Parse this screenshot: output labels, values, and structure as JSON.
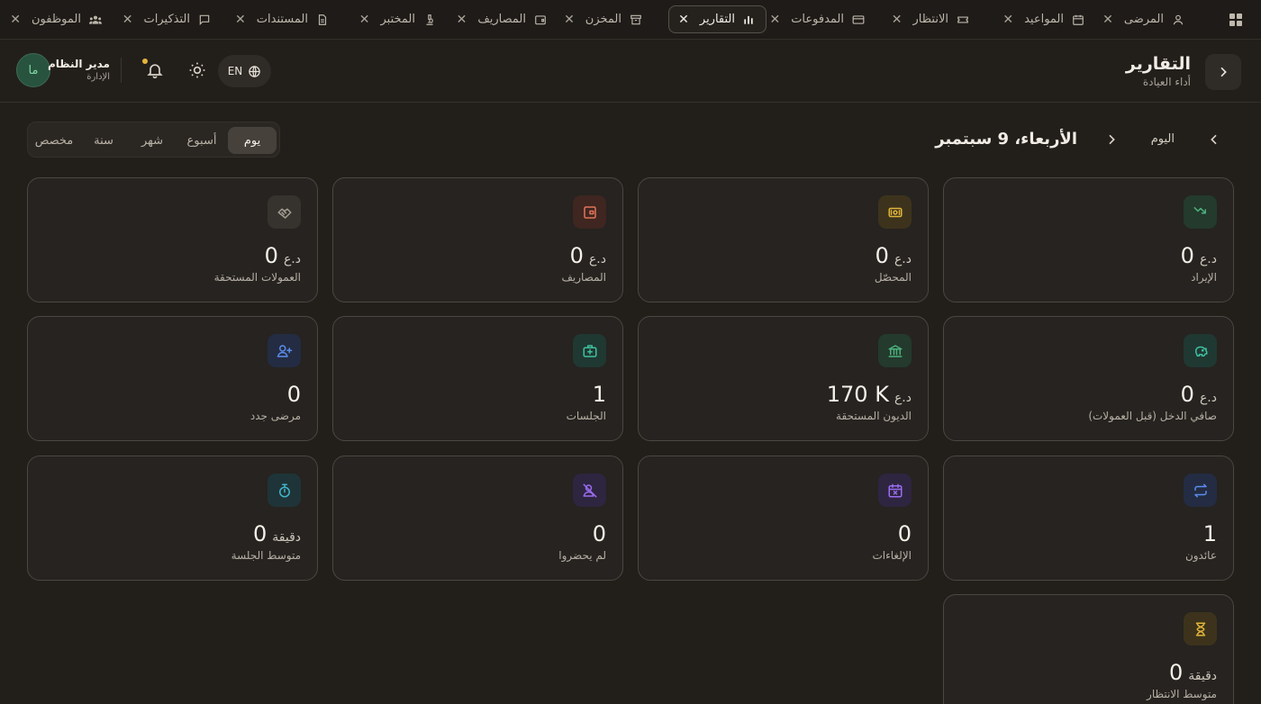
{
  "tabs": [
    {
      "label": "المرضى",
      "icon": "person-icon",
      "active": false
    },
    {
      "label": "المواعيد",
      "icon": "calendar-icon",
      "active": false
    },
    {
      "label": "الانتظار",
      "icon": "ticket-icon",
      "active": false
    },
    {
      "label": "المدفوعات",
      "icon": "credit-card-icon",
      "active": false
    },
    {
      "label": "التقارير",
      "icon": "bar-chart-icon",
      "active": true
    },
    {
      "label": "المخزن",
      "icon": "archive-icon",
      "active": false
    },
    {
      "label": "المصاريف",
      "icon": "wallet-icon",
      "active": false
    },
    {
      "label": "المختبر",
      "icon": "microscope-icon",
      "active": false
    },
    {
      "label": "المستندات",
      "icon": "document-icon",
      "active": false
    },
    {
      "label": "التذكيرات",
      "icon": "message-icon",
      "active": false
    },
    {
      "label": "الموظفون",
      "icon": "team-icon",
      "active": false
    }
  ],
  "header": {
    "title": "التقارير",
    "subtitle": "أداء العيادة",
    "language": "EN",
    "user": {
      "name": "مدير النظام",
      "role": "الإدارة",
      "initials": "ما"
    }
  },
  "period": {
    "options": [
      "يوم",
      "أسبوع",
      "شهر",
      "سنة",
      "مخصص"
    ],
    "selected": "يوم",
    "today_label": "اليوم",
    "date": "الأربعاء، 9 سبتمبر"
  },
  "cards": [
    {
      "label": "الإيراد",
      "value": "0",
      "unit": "د.ع",
      "icon": "trending-up-icon",
      "color": "#4caf7d",
      "bg": "#233a2d"
    },
    {
      "label": "المحصّل",
      "value": "0",
      "unit": "د.ع",
      "icon": "banknote-icon",
      "color": "#e0b43a",
      "bg": "#3d331c"
    },
    {
      "label": "المصاريف",
      "value": "0",
      "unit": "د.ع",
      "icon": "wallet-icon",
      "color": "#e2745a",
      "bg": "#3f2620"
    },
    {
      "label": "العمولات المستحقة",
      "value": "0",
      "unit": "د.ع",
      "icon": "handshake-icon",
      "color": "#a49d92",
      "bg": "#36322d"
    },
    {
      "label": "صافي الدخل (قبل العمولات)",
      "value": "0",
      "unit": "د.ع",
      "icon": "piggy-bank-icon",
      "color": "#3fbfa0",
      "bg": "#203832"
    },
    {
      "label": "الديون المستحقة",
      "value": "170 K",
      "unit": "د.ع",
      "icon": "bank-icon",
      "color": "#4caf7d",
      "bg": "#233a2d"
    },
    {
      "label": "الجلسات",
      "value": "1",
      "unit": "",
      "icon": "medical-bag-icon",
      "color": "#3fbfa0",
      "bg": "#203832"
    },
    {
      "label": "مرضى جدد",
      "value": "0",
      "unit": "",
      "icon": "user-plus-icon",
      "color": "#5b8def",
      "bg": "#232c42"
    },
    {
      "label": "عائدون",
      "value": "1",
      "unit": "",
      "icon": "repeat-icon",
      "color": "#5b8def",
      "bg": "#232c42"
    },
    {
      "label": "الإلغاءات",
      "value": "0",
      "unit": "",
      "icon": "calendar-x-icon",
      "color": "#9b6cf0",
      "bg": "#2e2540"
    },
    {
      "label": "لم يحضروا",
      "value": "0",
      "unit": "",
      "icon": "user-x-icon",
      "color": "#9b6cf0",
      "bg": "#2e2540"
    },
    {
      "label": "متوسط الجلسة",
      "value": "0",
      "unit": "دقيقة",
      "icon": "timer-icon",
      "color": "#3fb4c9",
      "bg": "#1f3438"
    },
    {
      "label": "متوسط الانتظار",
      "value": "0",
      "unit": "دقيقة",
      "icon": "hourglass-icon",
      "color": "#e0b43a",
      "bg": "#3d331c"
    }
  ]
}
